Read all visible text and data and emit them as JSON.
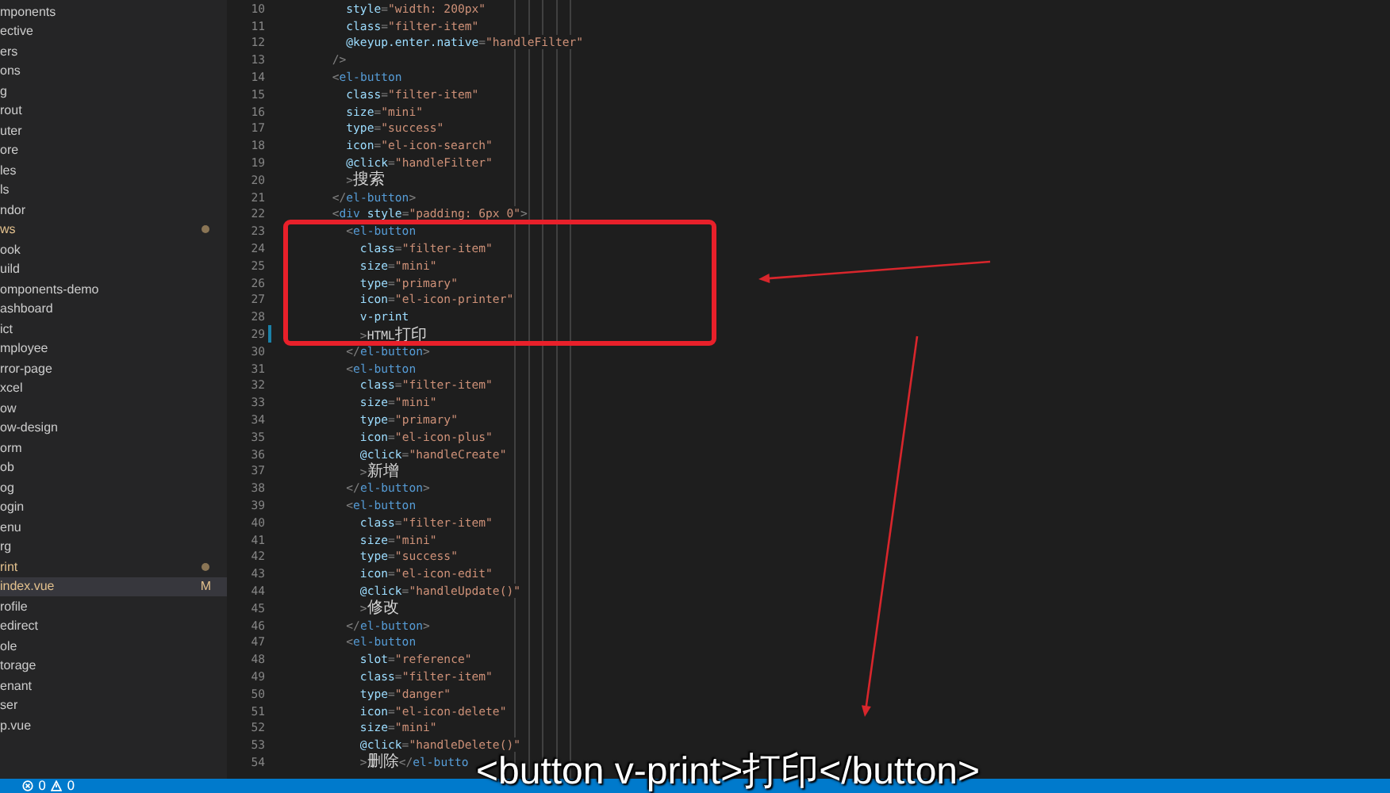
{
  "sidebar": {
    "items": [
      {
        "label": "mponents",
        "modified": false,
        "selected": false
      },
      {
        "label": "ective",
        "modified": false,
        "selected": false
      },
      {
        "label": "ers",
        "modified": false,
        "selected": false
      },
      {
        "label": "ons",
        "modified": false,
        "selected": false
      },
      {
        "label": "g",
        "modified": false,
        "selected": false
      },
      {
        "label": "rout",
        "modified": false,
        "selected": false
      },
      {
        "label": "uter",
        "modified": false,
        "selected": false
      },
      {
        "label": "ore",
        "modified": false,
        "selected": false
      },
      {
        "label": "les",
        "modified": false,
        "selected": false
      },
      {
        "label": "ls",
        "modified": false,
        "selected": false
      },
      {
        "label": "ndor",
        "modified": false,
        "selected": false
      },
      {
        "label": "ws",
        "modified": true,
        "selected": false
      },
      {
        "label": "ook",
        "modified": false,
        "selected": false
      },
      {
        "label": "uild",
        "modified": false,
        "selected": false
      },
      {
        "label": "omponents-demo",
        "modified": false,
        "selected": false
      },
      {
        "label": "ashboard",
        "modified": false,
        "selected": false
      },
      {
        "label": "ict",
        "modified": false,
        "selected": false
      },
      {
        "label": "mployee",
        "modified": false,
        "selected": false
      },
      {
        "label": "rror-page",
        "modified": false,
        "selected": false
      },
      {
        "label": "xcel",
        "modified": false,
        "selected": false
      },
      {
        "label": "ow",
        "modified": false,
        "selected": false
      },
      {
        "label": "ow-design",
        "modified": false,
        "selected": false
      },
      {
        "label": "orm",
        "modified": false,
        "selected": false
      },
      {
        "label": "ob",
        "modified": false,
        "selected": false
      },
      {
        "label": "og",
        "modified": false,
        "selected": false
      },
      {
        "label": "ogin",
        "modified": false,
        "selected": false
      },
      {
        "label": "enu",
        "modified": false,
        "selected": false
      },
      {
        "label": "rg",
        "modified": false,
        "selected": false
      },
      {
        "label": "rint",
        "modified": true,
        "selected": false
      },
      {
        "label": "index.vue",
        "modified": true,
        "selected": true,
        "badge": "M"
      },
      {
        "label": "rofile",
        "modified": false,
        "selected": false
      },
      {
        "label": "edirect",
        "modified": false,
        "selected": false
      },
      {
        "label": "ole",
        "modified": false,
        "selected": false
      },
      {
        "label": "torage",
        "modified": false,
        "selected": false
      },
      {
        "label": "enant",
        "modified": false,
        "selected": false
      },
      {
        "label": "ser",
        "modified": false,
        "selected": false
      },
      {
        "label": "p.vue",
        "modified": false,
        "selected": false
      }
    ]
  },
  "editor": {
    "lines": [
      {
        "number": "10",
        "modified": false,
        "tokens": [
          {
            "kind": "attr",
            "text": "        style"
          },
          {
            "kind": "punct",
            "text": "="
          },
          {
            "kind": "string",
            "text": "\"width: 200px\""
          }
        ]
      },
      {
        "number": "11",
        "modified": false,
        "tokens": [
          {
            "kind": "attr",
            "text": "        class"
          },
          {
            "kind": "punct",
            "text": "="
          },
          {
            "kind": "string",
            "text": "\"filter-item\""
          }
        ]
      },
      {
        "number": "12",
        "modified": false,
        "tokens": [
          {
            "kind": "attr",
            "text": "        @keyup.enter.native"
          },
          {
            "kind": "punct",
            "text": "="
          },
          {
            "kind": "string",
            "text": "\"handleFilter\""
          }
        ]
      },
      {
        "number": "13",
        "modified": false,
        "tokens": [
          {
            "kind": "punct",
            "text": "      />"
          }
        ]
      },
      {
        "number": "14",
        "modified": false,
        "tokens": [
          {
            "kind": "punct",
            "text": "      <"
          },
          {
            "kind": "tag",
            "text": "el-button"
          }
        ]
      },
      {
        "number": "15",
        "modified": false,
        "tokens": [
          {
            "kind": "attr",
            "text": "        class"
          },
          {
            "kind": "punct",
            "text": "="
          },
          {
            "kind": "string",
            "text": "\"filter-item\""
          }
        ]
      },
      {
        "number": "16",
        "modified": false,
        "tokens": [
          {
            "kind": "attr",
            "text": "        size"
          },
          {
            "kind": "punct",
            "text": "="
          },
          {
            "kind": "string",
            "text": "\"mini\""
          }
        ]
      },
      {
        "number": "17",
        "modified": false,
        "tokens": [
          {
            "kind": "attr",
            "text": "        type"
          },
          {
            "kind": "punct",
            "text": "="
          },
          {
            "kind": "string",
            "text": "\"success\""
          }
        ]
      },
      {
        "number": "18",
        "modified": false,
        "tokens": [
          {
            "kind": "attr",
            "text": "        icon"
          },
          {
            "kind": "punct",
            "text": "="
          },
          {
            "kind": "string",
            "text": "\"el-icon-search\""
          }
        ]
      },
      {
        "number": "19",
        "modified": false,
        "tokens": [
          {
            "kind": "attr",
            "text": "        @click"
          },
          {
            "kind": "punct",
            "text": "="
          },
          {
            "kind": "string",
            "text": "\"handleFilter\""
          }
        ]
      },
      {
        "number": "20",
        "modified": false,
        "tokens": [
          {
            "kind": "punct",
            "text": "        >"
          },
          {
            "kind": "cjk",
            "text": "搜索"
          }
        ]
      },
      {
        "number": "21",
        "modified": false,
        "tokens": [
          {
            "kind": "punct",
            "text": "      </"
          },
          {
            "kind": "tag",
            "text": "el-button"
          },
          {
            "kind": "punct",
            "text": ">"
          }
        ]
      },
      {
        "number": "22",
        "modified": false,
        "tokens": [
          {
            "kind": "punct",
            "text": "      <"
          },
          {
            "kind": "tag",
            "text": "div"
          },
          {
            "kind": "attr",
            "text": " style"
          },
          {
            "kind": "punct",
            "text": "="
          },
          {
            "kind": "string",
            "text": "\"padding: 6px 0\""
          },
          {
            "kind": "punct",
            "text": ">"
          }
        ]
      },
      {
        "number": "23",
        "modified": false,
        "tokens": [
          {
            "kind": "punct",
            "text": "        <"
          },
          {
            "kind": "tag",
            "text": "el-button"
          }
        ]
      },
      {
        "number": "24",
        "modified": false,
        "tokens": [
          {
            "kind": "attr",
            "text": "          class"
          },
          {
            "kind": "punct",
            "text": "="
          },
          {
            "kind": "string",
            "text": "\"filter-item\""
          }
        ]
      },
      {
        "number": "25",
        "modified": false,
        "tokens": [
          {
            "kind": "attr",
            "text": "          size"
          },
          {
            "kind": "punct",
            "text": "="
          },
          {
            "kind": "string",
            "text": "\"mini\""
          }
        ]
      },
      {
        "number": "26",
        "modified": false,
        "tokens": [
          {
            "kind": "attr",
            "text": "          type"
          },
          {
            "kind": "punct",
            "text": "="
          },
          {
            "kind": "string",
            "text": "\"primary\""
          }
        ]
      },
      {
        "number": "27",
        "modified": false,
        "tokens": [
          {
            "kind": "attr",
            "text": "          icon"
          },
          {
            "kind": "punct",
            "text": "="
          },
          {
            "kind": "string",
            "text": "\"el-icon-printer\""
          }
        ]
      },
      {
        "number": "28",
        "modified": false,
        "tokens": [
          {
            "kind": "attr",
            "text": "          v-print"
          }
        ]
      },
      {
        "number": "29",
        "modified": true,
        "tokens": [
          {
            "kind": "punct",
            "text": "          >"
          },
          {
            "kind": "text",
            "text": "HTML"
          },
          {
            "kind": "cjk",
            "text": "打印"
          }
        ]
      },
      {
        "number": "30",
        "modified": false,
        "tokens": [
          {
            "kind": "punct",
            "text": "        </"
          },
          {
            "kind": "tag",
            "text": "el-button"
          },
          {
            "kind": "punct",
            "text": ">"
          }
        ]
      },
      {
        "number": "31",
        "modified": false,
        "tokens": [
          {
            "kind": "punct",
            "text": "        <"
          },
          {
            "kind": "tag",
            "text": "el-button"
          }
        ]
      },
      {
        "number": "32",
        "modified": false,
        "tokens": [
          {
            "kind": "attr",
            "text": "          class"
          },
          {
            "kind": "punct",
            "text": "="
          },
          {
            "kind": "string",
            "text": "\"filter-item\""
          }
        ]
      },
      {
        "number": "33",
        "modified": false,
        "tokens": [
          {
            "kind": "attr",
            "text": "          size"
          },
          {
            "kind": "punct",
            "text": "="
          },
          {
            "kind": "string",
            "text": "\"mini\""
          }
        ]
      },
      {
        "number": "34",
        "modified": false,
        "tokens": [
          {
            "kind": "attr",
            "text": "          type"
          },
          {
            "kind": "punct",
            "text": "="
          },
          {
            "kind": "string",
            "text": "\"primary\""
          }
        ]
      },
      {
        "number": "35",
        "modified": false,
        "tokens": [
          {
            "kind": "attr",
            "text": "          icon"
          },
          {
            "kind": "punct",
            "text": "="
          },
          {
            "kind": "string",
            "text": "\"el-icon-plus\""
          }
        ]
      },
      {
        "number": "36",
        "modified": false,
        "tokens": [
          {
            "kind": "attr",
            "text": "          @click"
          },
          {
            "kind": "punct",
            "text": "="
          },
          {
            "kind": "string",
            "text": "\"handleCreate\""
          }
        ]
      },
      {
        "number": "37",
        "modified": false,
        "tokens": [
          {
            "kind": "punct",
            "text": "          >"
          },
          {
            "kind": "cjk",
            "text": "新增"
          }
        ]
      },
      {
        "number": "38",
        "modified": false,
        "tokens": [
          {
            "kind": "punct",
            "text": "        </"
          },
          {
            "kind": "tag",
            "text": "el-button"
          },
          {
            "kind": "punct",
            "text": ">"
          }
        ]
      },
      {
        "number": "39",
        "modified": false,
        "tokens": [
          {
            "kind": "punct",
            "text": "        <"
          },
          {
            "kind": "tag",
            "text": "el-button"
          }
        ]
      },
      {
        "number": "40",
        "modified": false,
        "tokens": [
          {
            "kind": "attr",
            "text": "          class"
          },
          {
            "kind": "punct",
            "text": "="
          },
          {
            "kind": "string",
            "text": "\"filter-item\""
          }
        ]
      },
      {
        "number": "41",
        "modified": false,
        "tokens": [
          {
            "kind": "attr",
            "text": "          size"
          },
          {
            "kind": "punct",
            "text": "="
          },
          {
            "kind": "string",
            "text": "\"mini\""
          }
        ]
      },
      {
        "number": "42",
        "modified": false,
        "tokens": [
          {
            "kind": "attr",
            "text": "          type"
          },
          {
            "kind": "punct",
            "text": "="
          },
          {
            "kind": "string",
            "text": "\"success\""
          }
        ]
      },
      {
        "number": "43",
        "modified": false,
        "tokens": [
          {
            "kind": "attr",
            "text": "          icon"
          },
          {
            "kind": "punct",
            "text": "="
          },
          {
            "kind": "string",
            "text": "\"el-icon-edit\""
          }
        ]
      },
      {
        "number": "44",
        "modified": false,
        "tokens": [
          {
            "kind": "attr",
            "text": "          @click"
          },
          {
            "kind": "punct",
            "text": "="
          },
          {
            "kind": "string",
            "text": "\"handleUpdate()\""
          }
        ]
      },
      {
        "number": "45",
        "modified": false,
        "tokens": [
          {
            "kind": "punct",
            "text": "          >"
          },
          {
            "kind": "cjk",
            "text": "修改"
          }
        ]
      },
      {
        "number": "46",
        "modified": false,
        "tokens": [
          {
            "kind": "punct",
            "text": "        </"
          },
          {
            "kind": "tag",
            "text": "el-button"
          },
          {
            "kind": "punct",
            "text": ">"
          }
        ]
      },
      {
        "number": "47",
        "modified": false,
        "tokens": [
          {
            "kind": "punct",
            "text": "        <"
          },
          {
            "kind": "tag",
            "text": "el-button"
          }
        ]
      },
      {
        "number": "48",
        "modified": false,
        "tokens": [
          {
            "kind": "attr",
            "text": "          slot"
          },
          {
            "kind": "punct",
            "text": "="
          },
          {
            "kind": "string",
            "text": "\"reference\""
          }
        ]
      },
      {
        "number": "49",
        "modified": false,
        "tokens": [
          {
            "kind": "attr",
            "text": "          class"
          },
          {
            "kind": "punct",
            "text": "="
          },
          {
            "kind": "string",
            "text": "\"filter-item\""
          }
        ]
      },
      {
        "number": "50",
        "modified": false,
        "tokens": [
          {
            "kind": "attr",
            "text": "          type"
          },
          {
            "kind": "punct",
            "text": "="
          },
          {
            "kind": "string",
            "text": "\"danger\""
          }
        ]
      },
      {
        "number": "51",
        "modified": false,
        "tokens": [
          {
            "kind": "attr",
            "text": "          icon"
          },
          {
            "kind": "punct",
            "text": "="
          },
          {
            "kind": "string",
            "text": "\"el-icon-delete\""
          }
        ]
      },
      {
        "number": "52",
        "modified": false,
        "tokens": [
          {
            "kind": "attr",
            "text": "          size"
          },
          {
            "kind": "punct",
            "text": "="
          },
          {
            "kind": "string",
            "text": "\"mini\""
          }
        ]
      },
      {
        "number": "53",
        "modified": false,
        "tokens": [
          {
            "kind": "attr",
            "text": "          @click"
          },
          {
            "kind": "punct",
            "text": "="
          },
          {
            "kind": "string",
            "text": "\"handleDelete()\""
          }
        ]
      },
      {
        "number": "54",
        "modified": false,
        "tokens": [
          {
            "kind": "punct",
            "text": "          >"
          },
          {
            "kind": "cjk",
            "text": "删除"
          },
          {
            "kind": "punct",
            "text": "</"
          },
          {
            "kind": "tag",
            "text": "el-butto"
          }
        ]
      }
    ]
  },
  "annotations": [
    {
      "kind": "box"
    },
    {
      "kind": "arrow"
    },
    {
      "kind": "arrow"
    }
  ],
  "subtitle": "<button v-print>打印</button>",
  "status_bar": {
    "errors": "0",
    "warnings": "0"
  }
}
